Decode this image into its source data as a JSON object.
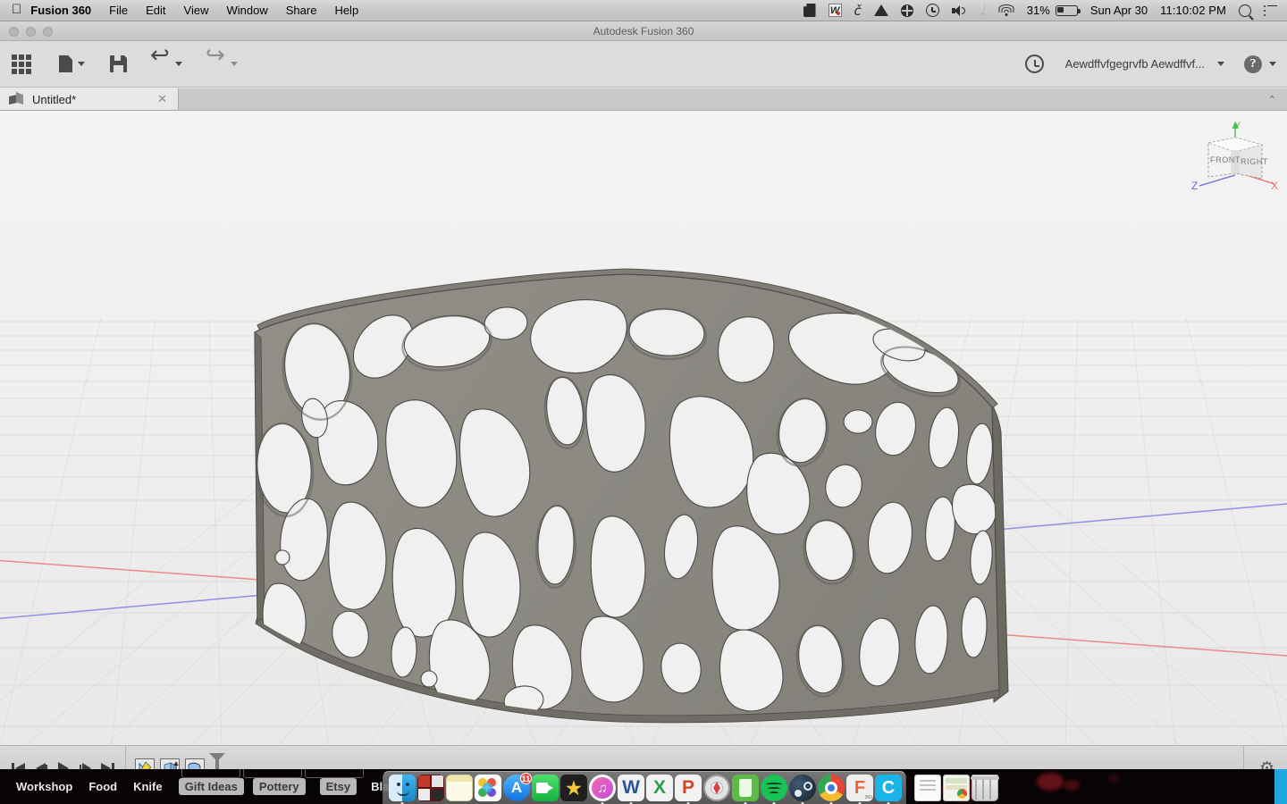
{
  "menubar": {
    "apple_icon": "apple-icon",
    "items": [
      {
        "label": "Fusion 360",
        "bold": true
      },
      {
        "label": "File"
      },
      {
        "label": "Edit"
      },
      {
        "label": "View"
      },
      {
        "label": "Window"
      },
      {
        "label": "Share"
      },
      {
        "label": "Help"
      }
    ],
    "status": {
      "evernote_icon": "evernote-icon",
      "word_icon": "microsoft-word-icon",
      "word_letter": "W",
      "cleanmymac_icon": "cleanmymac-icon",
      "cleanmymac_glyph": "č",
      "drive_icon": "google-drive-icon",
      "grammarly_icon": "grammarly-icon",
      "timemachine_icon": "time-machine-icon",
      "volume_icon": "volume-icon",
      "bluetooth_icon": "bluetooth-icon",
      "bluetooth_glyph": "ᛦ",
      "wifi_icon": "wifi-icon",
      "battery_percent": "31%",
      "battery_icon": "battery-icon",
      "date": "Sun Apr 30",
      "time": "11:10:02 PM",
      "search_icon": "spotlight-search-icon",
      "notification_icon": "notification-center-icon"
    }
  },
  "window": {
    "title": "Autodesk Fusion 360",
    "traffic_lights": [
      "close-button",
      "minimize-button",
      "zoom-button"
    ]
  },
  "toolbar": {
    "grid_icon": "show-data-panel-icon",
    "file_icon": "file-menu-icon",
    "file_caret": "chevron-down-icon",
    "save_icon": "save-icon",
    "undo_icon": "undo-icon",
    "undo_caret": "chevron-down-icon",
    "redo_icon": "redo-icon",
    "redo_caret": "chevron-down-icon",
    "history_icon": "job-status-icon",
    "username": "Aewdffvfgegrvfb Aewdffvf...",
    "username_caret": "chevron-down-icon",
    "help_icon": "help-icon",
    "help_label": "?",
    "help_caret": "chevron-down-icon"
  },
  "tabs": {
    "collapse_icon": "collapse-toolbar-icon",
    "collapse_glyph": "⌃",
    "items": [
      {
        "label": "Untitled*",
        "icon": "design-document-icon",
        "close": "✕",
        "active": true
      }
    ]
  },
  "viewport": {
    "model_name": "voronoi-curved-panel",
    "background_top": "#f2f2f2",
    "background_bottom": "#eaeaea",
    "grid_color": "#cfcfcf",
    "material_color": "#8e8c84",
    "x_axis_color": "#e8807f",
    "z_axis_color": "#8f8fe0",
    "viewcube": {
      "name": "view-cube",
      "front_label": "FRONT",
      "right_label": "RIGHT",
      "x_label": "X",
      "y_label": "Y",
      "z_label": "Z",
      "x_color": "#f07070",
      "y_color": "#4fbd4f",
      "z_color": "#6a6ae0"
    }
  },
  "timeline": {
    "playback": [
      {
        "name": "go-to-beginning-button",
        "glyph": "⏮"
      },
      {
        "name": "step-back-button",
        "glyph": "◀▕"
      },
      {
        "name": "play-button",
        "glyph": "▶"
      },
      {
        "name": "step-forward-button",
        "glyph": "▏▶"
      },
      {
        "name": "go-to-end-button",
        "glyph": "⏭"
      }
    ],
    "features": [
      {
        "name": "timeline-feature-sketch",
        "label": "sketch-feature-icon"
      },
      {
        "name": "timeline-feature-extrude",
        "label": "extrude-feature-icon"
      },
      {
        "name": "timeline-feature-revolve",
        "label": "revolve-feature-icon"
      }
    ],
    "marker_name": "timeline-playhead",
    "settings_icon": "timeline-settings-gear-icon",
    "settings_glyph": "⚙"
  },
  "bookmarks": {
    "items": [
      {
        "label": "Workshop",
        "boxed": false
      },
      {
        "label": "Food",
        "boxed": false
      },
      {
        "label": "Knife",
        "boxed": false
      },
      {
        "label": "Gift Ideas",
        "boxed": true
      },
      {
        "label": "Pottery",
        "boxed": true
      },
      {
        "label": "Etsy",
        "boxed": true
      },
      {
        "label": "Blas",
        "boxed": false
      }
    ]
  },
  "dock": {
    "items": [
      {
        "name": "finder",
        "label": "",
        "color": "#2e9fe0",
        "running": true,
        "glyph": "finder-icon"
      },
      {
        "name": "photo-collage",
        "label": "",
        "color": "#b33232",
        "running": false,
        "glyph": "collage-icon"
      },
      {
        "name": "notes",
        "label": "",
        "color": "#fdf2c2",
        "running": false,
        "glyph": "notes-icon"
      },
      {
        "name": "photos",
        "label": "",
        "color": "#f3f3f3",
        "running": false,
        "glyph": "photos-icon"
      },
      {
        "name": "app-store",
        "label": "",
        "color": "#1f8df3",
        "running": false,
        "glyph": "app-store-icon",
        "badge": "11"
      },
      {
        "name": "facetime",
        "label": "",
        "color": "#34c759",
        "running": false,
        "glyph": "facetime-icon"
      },
      {
        "name": "imovie",
        "label": "",
        "color": "#2b2b2b",
        "running": false,
        "glyph": "imovie-icon"
      },
      {
        "name": "itunes",
        "label": "",
        "color": "#f4f4f4",
        "running": true,
        "glyph": "itunes-icon"
      },
      {
        "name": "microsoft-word",
        "label": "W",
        "color": "#2b579a",
        "running": true,
        "glyph": "word-icon"
      },
      {
        "name": "microsoft-excel",
        "label": "X",
        "color": "#217346",
        "running": false,
        "glyph": "excel-icon"
      },
      {
        "name": "microsoft-powerpoint",
        "label": "P",
        "color": "#d24726",
        "running": true,
        "glyph": "powerpoint-icon"
      },
      {
        "name": "safari",
        "label": "",
        "color": "#d7d7d7",
        "running": false,
        "glyph": "safari-icon"
      },
      {
        "name": "evernote",
        "label": "",
        "color": "#5aba47",
        "running": true,
        "glyph": "evernote-icon"
      },
      {
        "name": "spotify",
        "label": "",
        "color": "#1db954",
        "running": true,
        "glyph": "spotify-icon"
      },
      {
        "name": "steam",
        "label": "",
        "color": "#1b2838",
        "running": false,
        "glyph": "steam-icon"
      },
      {
        "name": "google-chrome",
        "label": "",
        "color": "#f4f4f4",
        "running": true,
        "glyph": "chrome-icon"
      },
      {
        "name": "fusion-360",
        "label": "F",
        "color": "#e8e8e8",
        "running": true,
        "glyph": "fusion360-icon"
      },
      {
        "name": "cura",
        "label": "C",
        "color": "#19b8e8",
        "running": true,
        "glyph": "cura-icon"
      }
    ],
    "stacks": [
      {
        "name": "documents-stack",
        "glyph": "document-stack-icon"
      },
      {
        "name": "downloads-stack",
        "glyph": "downloads-stack-icon"
      },
      {
        "name": "trash",
        "glyph": "trash-icon"
      }
    ]
  }
}
